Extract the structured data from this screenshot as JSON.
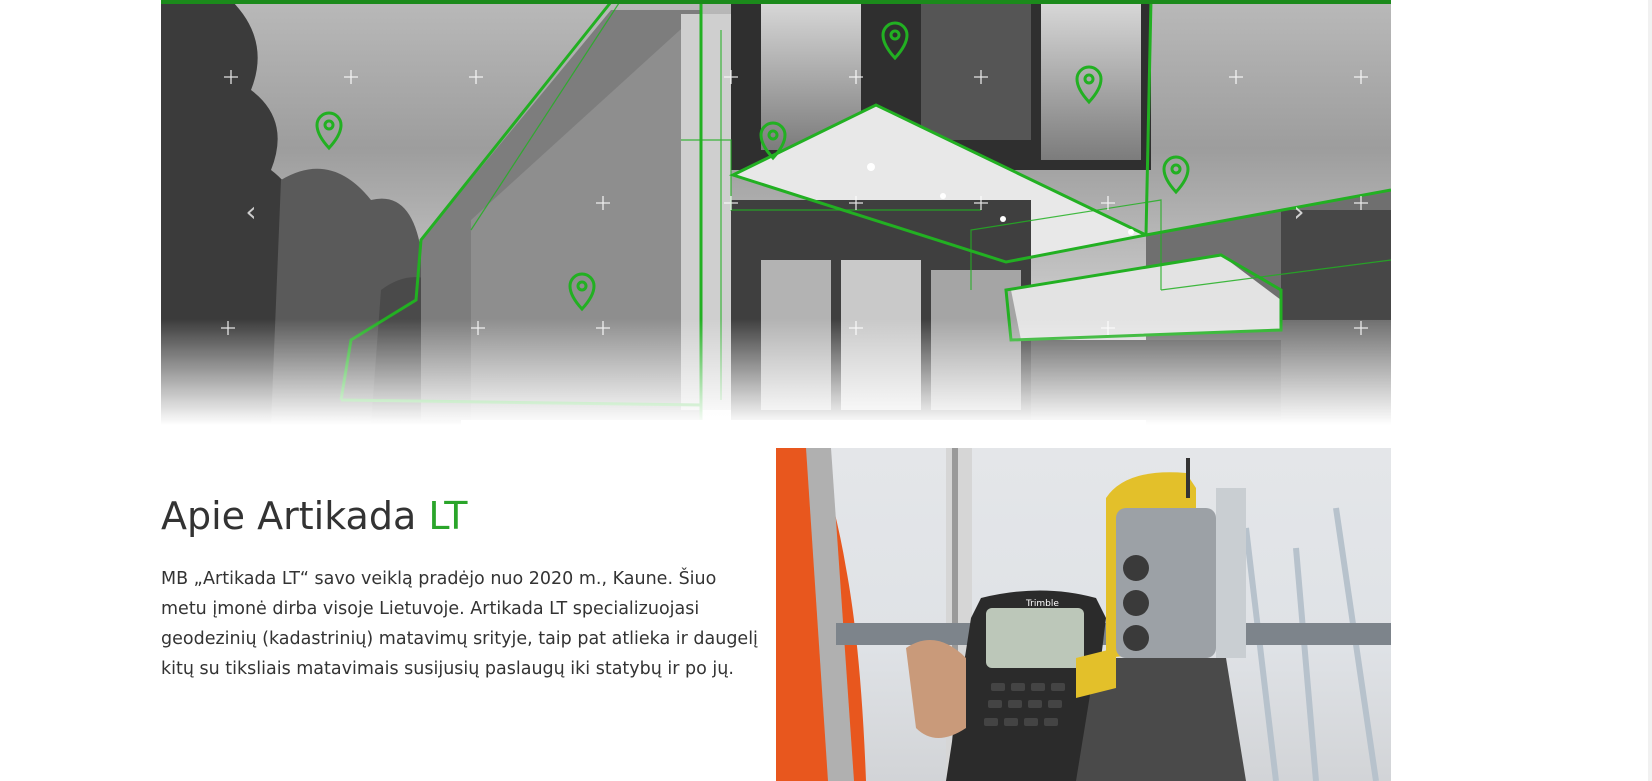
{
  "hero": {
    "prev_arrow": "‹",
    "next_arrow": "›",
    "brand_color": "#22b022",
    "icons": [
      "location-pin-icon",
      "plus-icon"
    ]
  },
  "about": {
    "title_main": "Apie Artikada ",
    "title_accent": "LT",
    "accent_color": "#2aa52a",
    "text": "MB „Artikada LT“ savo veiklą pradėjo nuo 2020 m., Kaune. Šiuo metu įmonė dirba visoje Lietuvoje. Artikada LT specializuojasi geodezinių (kadastrinių) matavimų srityje, taip pat atlieka ir daugelį kitų su tiksliais matavimais susijusių paslaugų iki statybų ir po jų."
  },
  "photo": {
    "device_brand": "Trimble"
  }
}
